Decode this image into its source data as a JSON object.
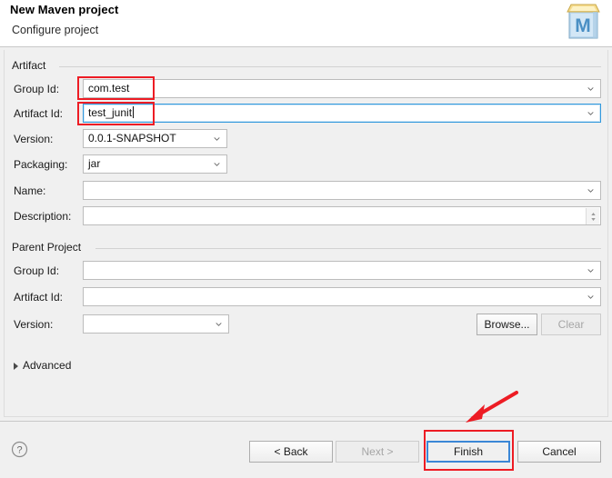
{
  "window": {
    "title": "New Maven project",
    "subtitle": "Configure project",
    "icon": "maven-project-icon"
  },
  "artifact_group": {
    "legend": "Artifact",
    "fields": [
      {
        "label": "Group Id:",
        "value": "com.test",
        "type": "combo",
        "highlighted": true,
        "focused": false,
        "caret": false
      },
      {
        "label": "Artifact Id:",
        "value": "test_junit",
        "type": "combo",
        "highlighted": true,
        "focused": true,
        "caret": true
      },
      {
        "label": "Version:",
        "value": "0.0.1-SNAPSHOT",
        "type": "combo",
        "highlighted": false,
        "focused": false,
        "caret": false
      },
      {
        "label": "Packaging:",
        "value": "jar",
        "type": "combo",
        "highlighted": false,
        "focused": false,
        "caret": false
      },
      {
        "label": "Name:",
        "value": "",
        "type": "combo",
        "highlighted": false,
        "focused": false,
        "caret": false
      },
      {
        "label": "Description:",
        "value": "",
        "type": "textarea",
        "highlighted": false,
        "focused": false,
        "caret": false
      }
    ]
  },
  "parent_group": {
    "legend": "Parent Project",
    "fields": [
      {
        "label": "Group Id:",
        "value": "",
        "type": "combo"
      },
      {
        "label": "Artifact Id:",
        "value": "",
        "type": "combo"
      },
      {
        "label": "Version:",
        "value": "",
        "type": "combo"
      }
    ],
    "browse_button": {
      "label": "Browse...",
      "enabled": true
    },
    "clear_button": {
      "label": "Clear",
      "enabled": false
    }
  },
  "advanced": {
    "label": "Advanced",
    "expanded": false
  },
  "footer": {
    "help_icon": "help-question-icon",
    "buttons": [
      {
        "label": "< Back",
        "enabled": true,
        "default": false
      },
      {
        "label": "Next >",
        "enabled": false,
        "default": false
      },
      {
        "label": "Finish",
        "enabled": true,
        "default": true
      },
      {
        "label": "Cancel",
        "enabled": true,
        "default": false
      }
    ]
  },
  "annotations": {
    "color": "#ed1c24",
    "arrow_target": "finish-button",
    "boxes": [
      "group-id-value",
      "artifact-id-value",
      "finish-button"
    ]
  }
}
